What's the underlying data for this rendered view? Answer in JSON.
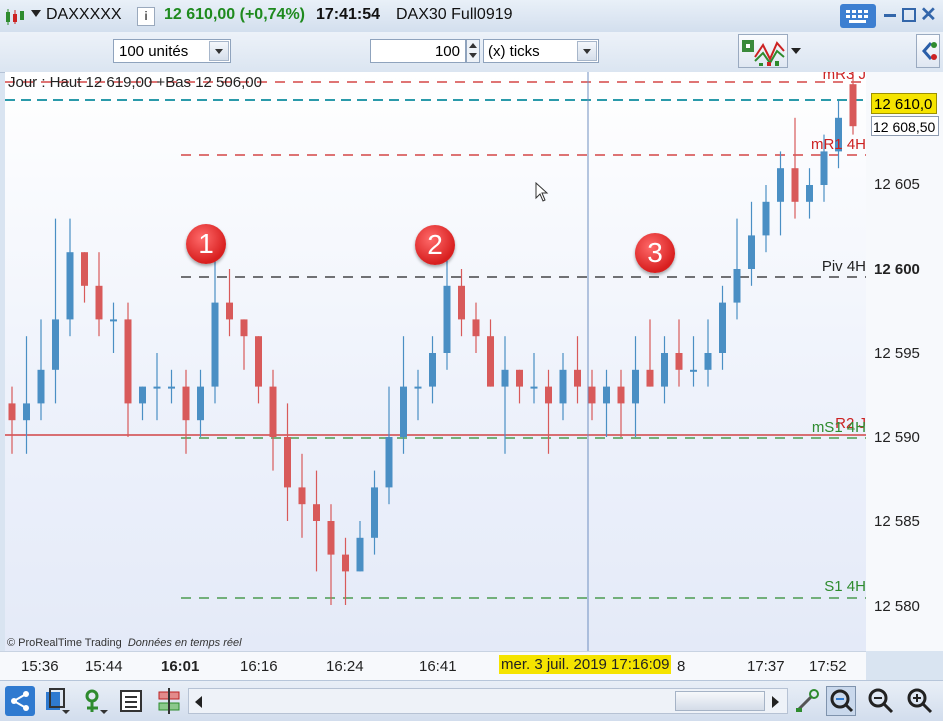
{
  "titlebar": {
    "instrument": "DAXXXXX",
    "price_change": "12 610,00 (+0,74%)",
    "time": "17:41:54",
    "product": "DAX30 Full0919"
  },
  "toolbar": {
    "quantity_select": "100 unités",
    "tick_value": "100",
    "unit_select": "(x) ticks"
  },
  "chart": {
    "header": "Jour : Haut 12 619,00 +Bas 12 506,00",
    "copyright": "© ProRealTime Trading",
    "realtime": "Données en temps réel",
    "cursor_date": "mer. 3 juil. 2019 17:16:09",
    "markers": [
      "1",
      "2",
      "3"
    ],
    "levels": {
      "mR3": "mR3 J",
      "mR1": "mR1 4H",
      "piv": "Piv 4H",
      "r2": "R2 J",
      "ms1": "mS1 4H",
      "s1": "S1 4H"
    },
    "price_tags": {
      "last": "12 610,0",
      "cursor": "12 608,50"
    },
    "y_ticks": [
      "12 605",
      "12 600",
      "12 595",
      "12 590",
      "12 585",
      "12 580"
    ],
    "x_ticks": [
      "15:36",
      "15:44",
      "16:01",
      "16:16",
      "16:24",
      "16:41",
      "8",
      "17:37",
      "17:52"
    ],
    "colors": {
      "up": "#4a8fc4",
      "down": "#d85a5a",
      "green": "#2e8b2e",
      "red": "#cc2222",
      "highlight": "#f5e400"
    }
  },
  "chart_data": {
    "type": "candlestick",
    "ylim": [
      12578,
      12614
    ],
    "open": [
      12592,
      12591,
      12592,
      12594,
      12597,
      12601,
      12599,
      12597,
      12597,
      12592,
      12593,
      12593,
      12593,
      12591,
      12593,
      12598,
      12597,
      12596,
      12593,
      12590,
      12587,
      12586,
      12585,
      12583,
      12582,
      12584,
      12587,
      12590,
      12593,
      12593,
      12595,
      12599,
      12597,
      12596,
      12593,
      12594,
      12593,
      12593,
      12592,
      12594,
      12593,
      12592,
      12593,
      12592,
      12594,
      12593,
      12595,
      12594,
      12594,
      12595,
      12598,
      12600,
      12602,
      12604,
      12606,
      12604,
      12605,
      12607,
      12611
    ],
    "close": [
      12591,
      12592,
      12594,
      12597,
      12601,
      12599,
      12597,
      12597,
      12592,
      12593,
      12593,
      12593,
      12591,
      12593,
      12598,
      12597,
      12596,
      12593,
      12590,
      12587,
      12586,
      12585,
      12583,
      12582,
      12584,
      12587,
      12590,
      12593,
      12593,
      12595,
      12599,
      12597,
      12596,
      12593,
      12594,
      12593,
      12593,
      12592,
      12594,
      12593,
      12592,
      12593,
      12592,
      12594,
      12593,
      12595,
      12594,
      12594,
      12595,
      12598,
      12600,
      12602,
      12604,
      12606,
      12604,
      12605,
      12607,
      12609,
      12608.5
    ],
    "high": [
      12593,
      12596,
      12597,
      12603,
      12603,
      12601,
      12601,
      12598,
      12598,
      12593,
      12595,
      12594,
      12594,
      12594,
      12601,
      12600,
      12597,
      12596,
      12594,
      12592,
      12589,
      12588,
      12586,
      12584,
      12585,
      12588,
      12593,
      12596,
      12594,
      12596,
      12601,
      12600,
      12598,
      12597,
      12596,
      12594,
      12595,
      12594,
      12595,
      12596,
      12594,
      12594,
      12594,
      12596,
      12597,
      12596,
      12597,
      12596,
      12597,
      12599,
      12603,
      12604,
      12605,
      12607,
      12609,
      12606,
      12608,
      12610,
      12613
    ],
    "low": [
      12589,
      12589,
      12591,
      12592,
      12596,
      12598,
      12596,
      12595,
      12590,
      12591,
      12591,
      12592,
      12589,
      12590,
      12592,
      12596,
      12594,
      12592,
      12588,
      12585,
      12584,
      12582,
      12580,
      12580,
      12582,
      12583,
      12586,
      12589,
      12591,
      12592,
      12594,
      12596,
      12595,
      12593,
      12589,
      12592,
      12592,
      12589,
      12591,
      12592,
      12591,
      12590,
      12590,
      12590,
      12593,
      12592,
      12593,
      12593,
      12593,
      12594,
      12597,
      12599,
      12601,
      12602,
      12603,
      12603,
      12604,
      12606,
      12608
    ]
  },
  "bottombar": {
    "icons": [
      "share-icon",
      "layout-icon",
      "indicator-icon",
      "list-icon",
      "compare-icon",
      "scroll-left-icon",
      "scroll-right-icon",
      "settings-icon",
      "zoom-area-icon",
      "zoom-out-icon",
      "zoom-in-icon"
    ]
  }
}
